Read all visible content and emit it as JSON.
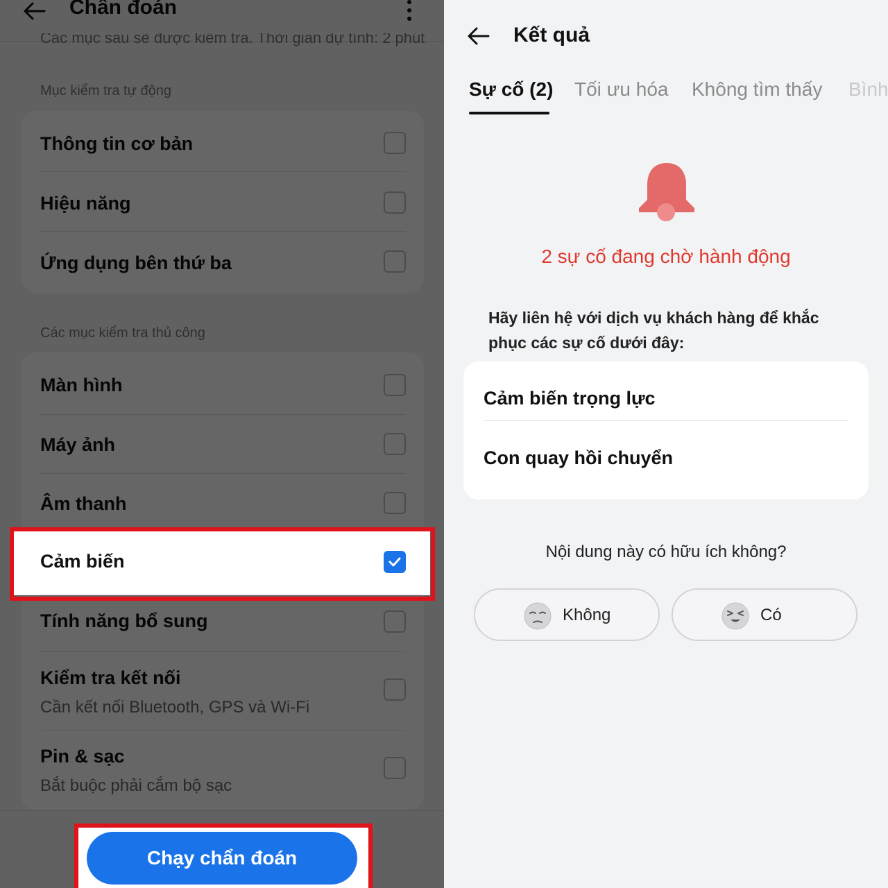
{
  "left": {
    "title": "Chẩn đoán",
    "subtitle": "Các mục sau sẽ được kiểm tra. Thời gian dự tính: 2 phút",
    "auto_section_label": "Mục kiểm tra tự động",
    "auto_items": [
      {
        "label": "Thông tin cơ bản",
        "checked": false
      },
      {
        "label": "Hiệu năng",
        "checked": false
      },
      {
        "label": "Ứng dụng bên thứ ba",
        "checked": false
      }
    ],
    "manual_section_label": "Các mục kiểm tra thủ công",
    "manual_items": [
      {
        "label": "Màn hình",
        "checked": false
      },
      {
        "label": "Máy ảnh",
        "checked": false
      },
      {
        "label": "Âm thanh",
        "checked": false
      },
      {
        "label": "Cảm biến",
        "checked": true
      },
      {
        "label": "Tính năng bổ sung",
        "checked": false
      },
      {
        "label": "Kiểm tra kết nối",
        "sub": "Cần kết nối Bluetooth, GPS và Wi-Fi",
        "checked": false
      },
      {
        "label": "Pin & sạc",
        "sub": "Bắt buộc phải cắm bộ sạc",
        "checked": false
      }
    ],
    "run_button": "Chạy chẩn đoán",
    "highlight_color": "#e0131b",
    "accent_color": "#1a73e8"
  },
  "right": {
    "title": "Kết quả",
    "tabs": [
      "Sự cố (2)",
      "Tối ưu hóa",
      "Không tìm thấy",
      "Bình thường"
    ],
    "active_tab": 0,
    "alert_icon": "bell-icon",
    "alert_text": "2 sự cố đang chờ hành động",
    "alert_color": "#e0382d",
    "advice": "Hãy liên hệ với dịch vụ khách hàng để khắc phục các sự cố dưới đây:",
    "issues": [
      "Cảm biến trọng lực",
      "Con quay hồi chuyển"
    ],
    "feedback_question": "Nội dung này có hữu ích không?",
    "feedback_no": "Không",
    "feedback_yes": "Có"
  }
}
